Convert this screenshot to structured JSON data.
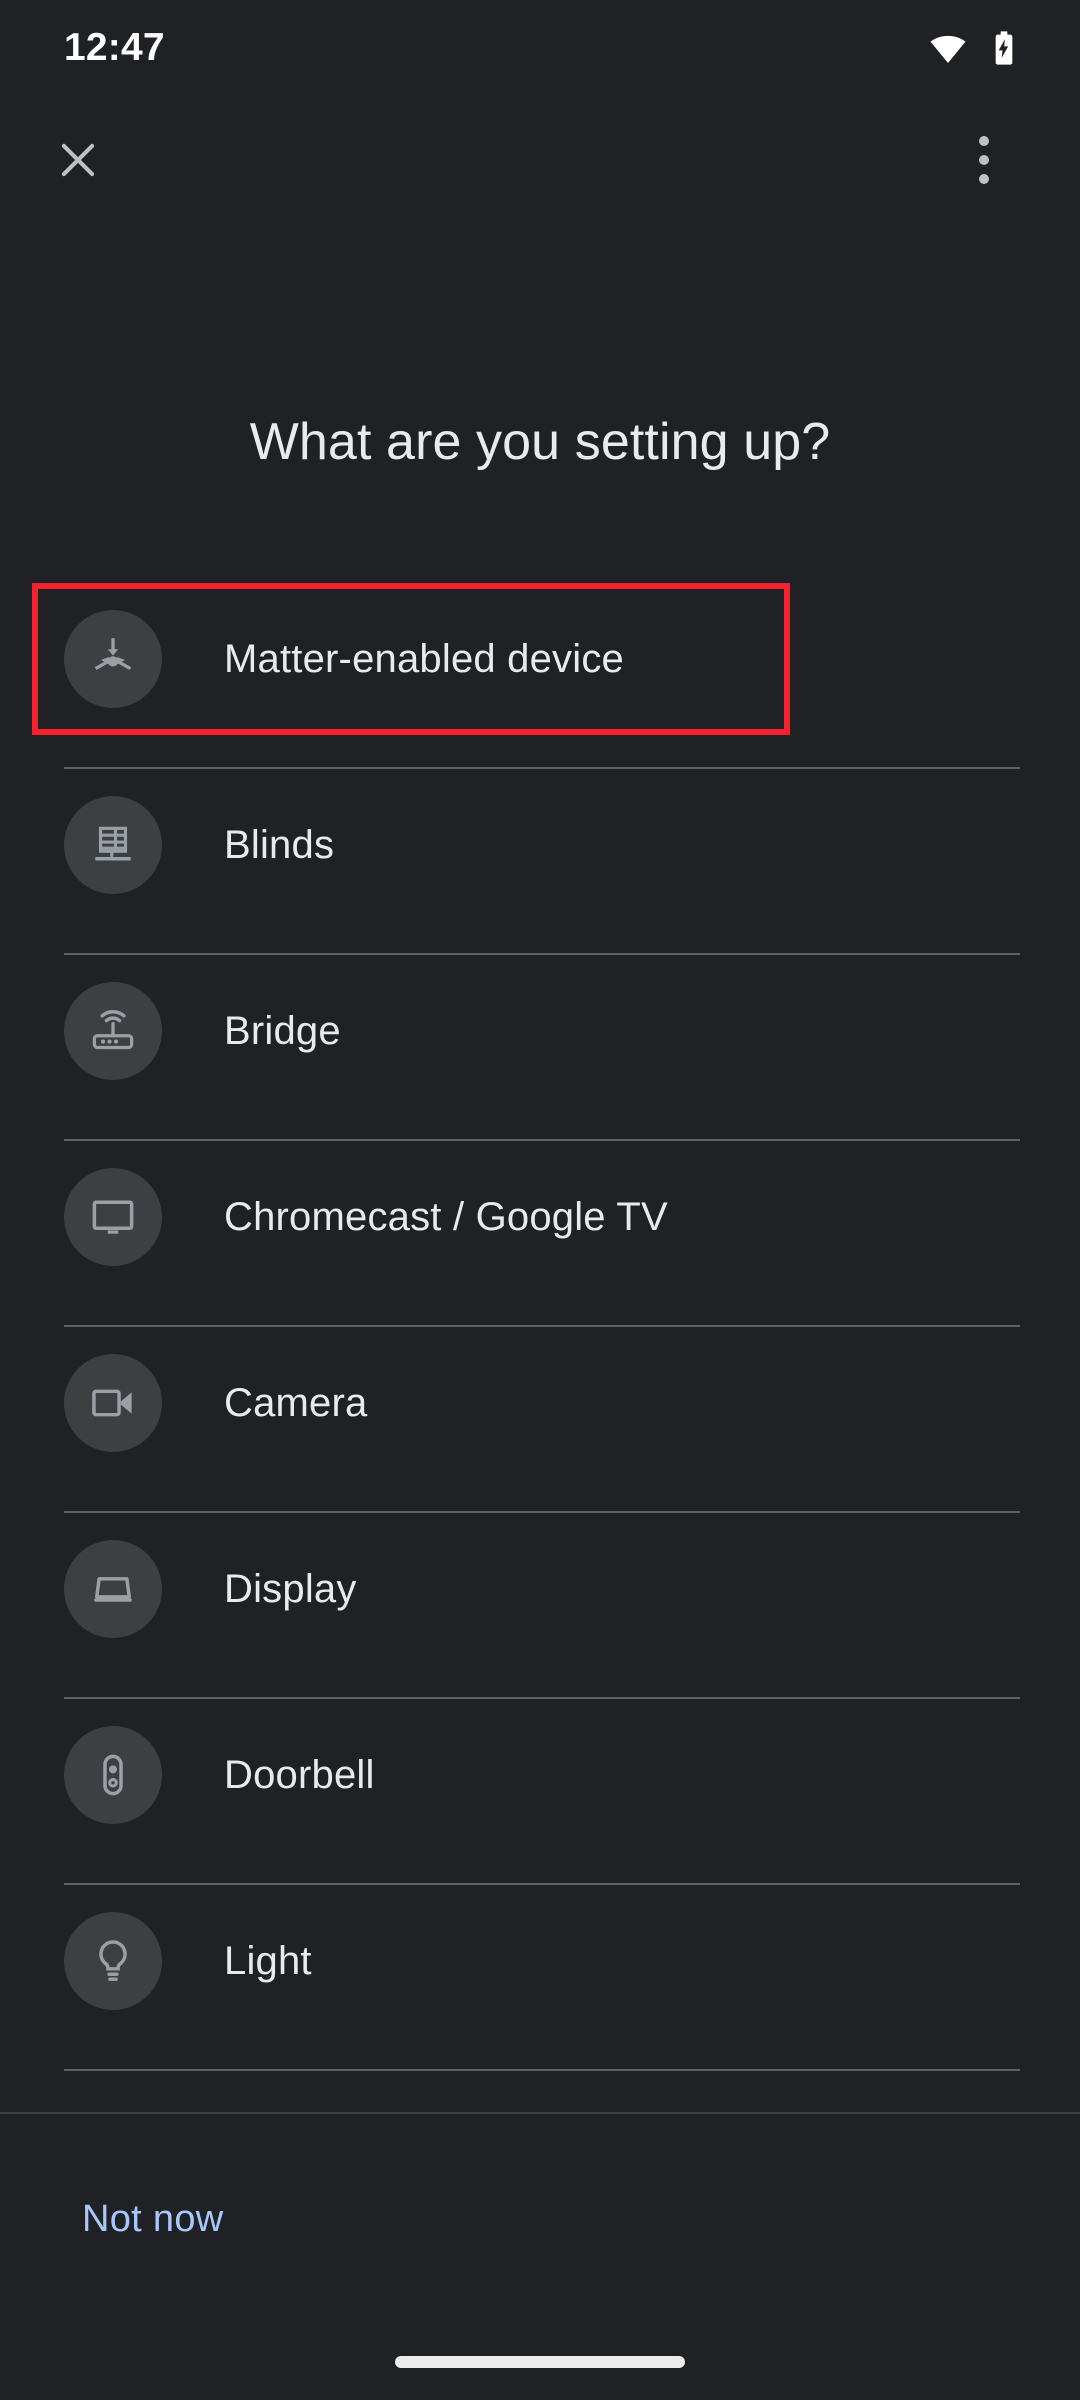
{
  "status_bar": {
    "time": "12:47",
    "icons": [
      "wifi-full-icon",
      "battery-charging-icon"
    ]
  },
  "app_bar": {
    "close_icon": "close-icon",
    "overflow_icon": "more-vert-icon"
  },
  "page_title": "What are you setting up?",
  "device_list": [
    {
      "label": "Matter-enabled device",
      "icon": "matter-logo-icon",
      "highlighted": true
    },
    {
      "label": "Blinds",
      "icon": "blinds-icon"
    },
    {
      "label": "Bridge",
      "icon": "router-bridge-icon"
    },
    {
      "label": "Chromecast / Google TV",
      "icon": "tv-icon"
    },
    {
      "label": "Camera",
      "icon": "videocam-icon"
    },
    {
      "label": "Display",
      "icon": "smart-display-icon"
    },
    {
      "label": "Doorbell",
      "icon": "doorbell-icon"
    },
    {
      "label": "Light",
      "icon": "lightbulb-icon"
    }
  ],
  "footer": {
    "not_now_label": "Not now"
  },
  "colors": {
    "background": "#202124",
    "avatar_background": "#3c4043",
    "icon": "#9aa0a6",
    "primary_text": "#e8eaed",
    "divider": "#5f6368",
    "link": "#a8c7fa",
    "highlight_box": "#f5222d"
  }
}
